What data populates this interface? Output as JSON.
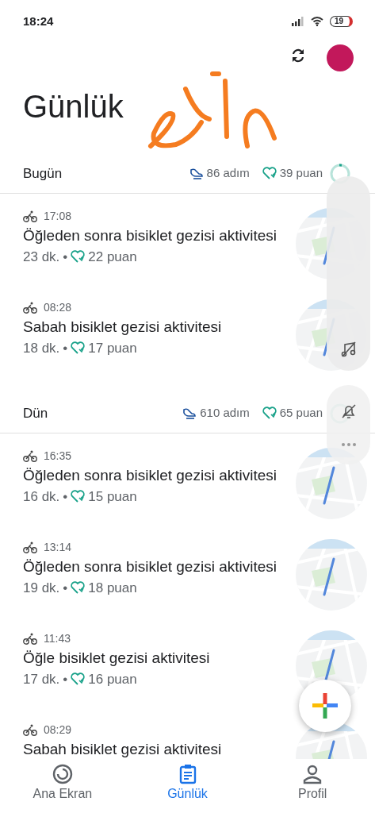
{
  "status_bar": {
    "time": "18:24",
    "battery": "19"
  },
  "header": {
    "title": "Günlük"
  },
  "days": [
    {
      "label": "Bugün",
      "steps": "86 adım",
      "points": "39 puan",
      "activities": [
        {
          "time": "17:08",
          "title": "Öğleden sonra bisiklet gezisi aktivitesi",
          "duration": "23 dk.",
          "separator": "•",
          "points": "22 puan"
        },
        {
          "time": "08:28",
          "title": "Sabah bisiklet gezisi aktivitesi",
          "duration": "18 dk.",
          "separator": "•",
          "points": "17 puan"
        }
      ]
    },
    {
      "label": "Dün",
      "steps": "610 adım",
      "points": "65 puan",
      "activities": [
        {
          "time": "16:35",
          "title": "Öğleden sonra bisiklet gezisi aktivitesi",
          "duration": "16 dk.",
          "separator": "•",
          "points": "15 puan"
        },
        {
          "time": "13:14",
          "title": "Öğleden sonra bisiklet gezisi aktivitesi",
          "duration": "19 dk.",
          "separator": "•",
          "points": "18 puan"
        },
        {
          "time": "11:43",
          "title": "Öğle bisiklet gezisi aktivitesi",
          "duration": "17 dk.",
          "separator": "•",
          "points": "16 puan"
        },
        {
          "time": "08:29",
          "title": "Sabah bisiklet gezisi aktivitesi"
        }
      ]
    }
  ],
  "bottom_nav": [
    {
      "label": "Ana Ekran",
      "selected": false
    },
    {
      "label": "Günlük",
      "selected": true
    },
    {
      "label": "Profil",
      "selected": false
    }
  ]
}
